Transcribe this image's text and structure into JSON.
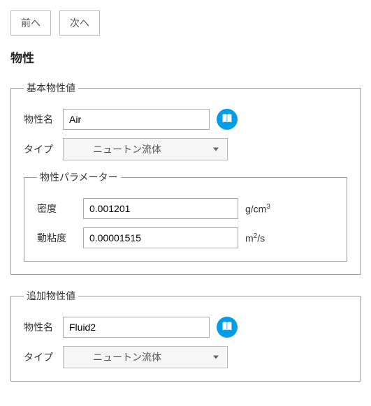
{
  "nav": {
    "prev": "前へ",
    "next": "次へ"
  },
  "title": "物性",
  "basic": {
    "legend": "基本物性値",
    "name_label": "物性名",
    "name_value": "Air",
    "type_label": "タイプ",
    "type_value": "ニュートン流体",
    "params": {
      "legend": "物性パラメーター",
      "density_label": "密度",
      "density_value": "0.001201",
      "density_unit": "g/cm",
      "viscosity_label": "動粘度",
      "viscosity_value": "0.00001515",
      "viscosity_unit": "m",
      "viscosity_unit_suffix": "/s"
    }
  },
  "additional": {
    "legend": "追加物性値",
    "name_label": "物性名",
    "name_value": "Fluid2",
    "type_label": "タイプ",
    "type_value": "ニュートン流体"
  }
}
